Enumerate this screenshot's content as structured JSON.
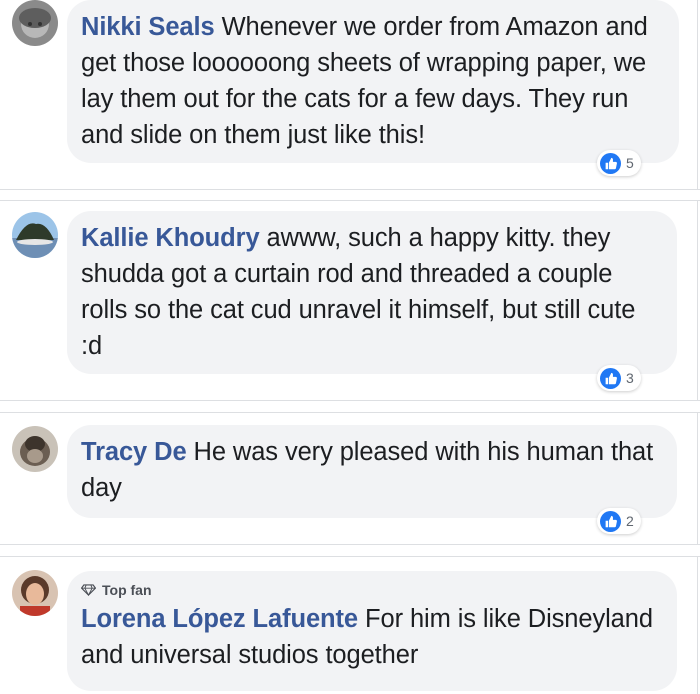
{
  "colors": {
    "author": "#385898",
    "bubble": "#f2f3f5",
    "like": "#2078f4",
    "text": "#1c1e21"
  },
  "comments": [
    {
      "author": "Nikki Seals",
      "text": "Whenever we order from Amazon and get those loooooong sheets of wrapping paper, we lay them out for the cats for a few days. They run and slide on them just like this!",
      "reaction_icon": "like-icon",
      "reaction_count": "5"
    },
    {
      "author": "Kallie Khoudry",
      "text": "awww, such a happy kitty. they shudda got a curtain rod and threaded a couple rolls so the cat cud unravel it himself, but still cute :d",
      "reaction_icon": "like-icon",
      "reaction_count": "3"
    },
    {
      "author": "Tracy De",
      "text": "He was very pleased with his human that day",
      "reaction_icon": "like-icon",
      "reaction_count": "2"
    },
    {
      "badge_icon": "diamond-icon",
      "badge": "Top fan",
      "author": "Lorena López Lafuente",
      "text": "For him is like Disneyland and universal studios together"
    }
  ]
}
